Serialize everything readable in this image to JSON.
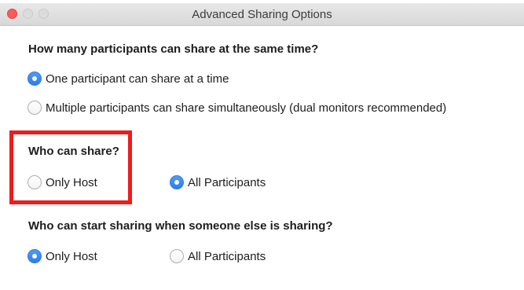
{
  "window": {
    "title": "Advanced Sharing Options"
  },
  "sections": [
    {
      "heading": "How many participants can share at the same time?",
      "options": [
        {
          "label": "One participant can share at a time",
          "selected": true
        },
        {
          "label": "Multiple participants can share simultaneously (dual monitors recommended)",
          "selected": false
        }
      ]
    },
    {
      "heading": "Who can share?",
      "options": [
        {
          "label": "Only Host",
          "selected": false
        },
        {
          "label": "All Participants",
          "selected": true
        }
      ]
    },
    {
      "heading": "Who can start sharing when someone else is sharing?",
      "options": [
        {
          "label": "Only Host",
          "selected": true
        },
        {
          "label": "All Participants",
          "selected": false
        }
      ]
    }
  ],
  "colors": {
    "highlight_box": "#ee1c1c",
    "radio_selected": "#2f7cf1",
    "close_button": "#fd5b57"
  }
}
